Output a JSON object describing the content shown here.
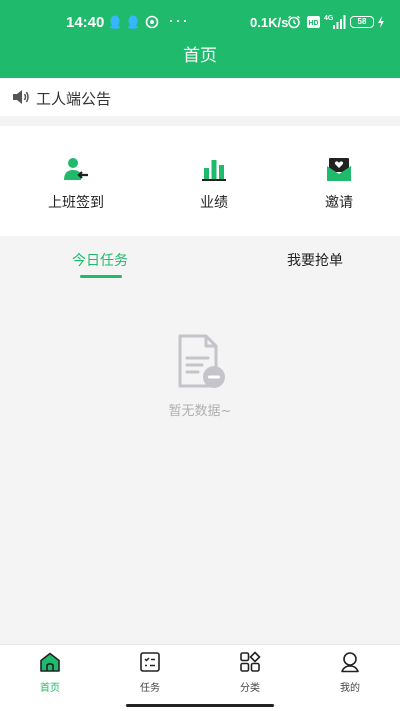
{
  "status_bar": {
    "time": "14:40",
    "more": "···",
    "net_speed": "0.1K/s",
    "hd": "HD",
    "network": "4G",
    "battery": "58"
  },
  "header": {
    "title": "首页"
  },
  "notice": {
    "text": "工人端公告",
    "icon": "speaker-icon"
  },
  "menu": {
    "items": [
      {
        "label": "上班签到",
        "icon": "checkin-user-icon"
      },
      {
        "label": "业绩",
        "icon": "bar-chart-icon"
      },
      {
        "label": "邀请",
        "icon": "invite-envelope-icon"
      }
    ]
  },
  "tabs": {
    "items": [
      {
        "label": "今日任务",
        "active": true
      },
      {
        "label": "我要抢单",
        "active": false
      }
    ]
  },
  "empty": {
    "text": "暂无数据~",
    "icon": "empty-document-icon"
  },
  "tabbar": {
    "items": [
      {
        "label": "首页",
        "icon": "home-icon",
        "active": true
      },
      {
        "label": "任务",
        "icon": "task-list-icon",
        "active": false
      },
      {
        "label": "分类",
        "icon": "category-icon",
        "active": false
      },
      {
        "label": "我的",
        "icon": "profile-icon",
        "active": false
      }
    ]
  },
  "colors": {
    "brand": "#1fba6b",
    "background": "#f4f4f4",
    "muted": "#b0b0b0"
  }
}
